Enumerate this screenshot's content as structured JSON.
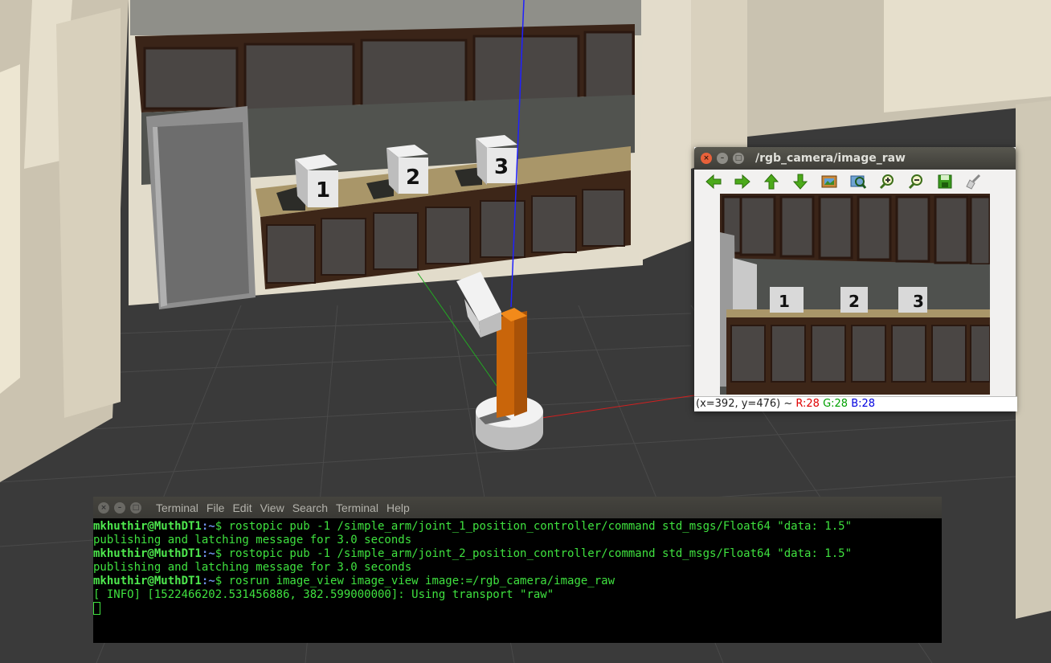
{
  "image_view": {
    "title": "/rgb_camera/image_raw",
    "toolbar_icons": [
      "arrow-left-icon",
      "arrow-right-icon",
      "arrow-up-icon",
      "arrow-down-icon",
      "image-icon",
      "fit-icon",
      "zoom-in-icon",
      "zoom-out-icon",
      "save-icon",
      "clear-icon"
    ],
    "cubes": [
      "1",
      "2",
      "3"
    ],
    "status": {
      "coords": "(x=392, y=476) ~ ",
      "r": "R:28",
      "g": "G:28",
      "b": "B:28"
    }
  },
  "scene": {
    "cubes": [
      "1",
      "2",
      "3"
    ]
  },
  "terminal": {
    "menu": [
      "Terminal",
      "File",
      "Edit",
      "View",
      "Search",
      "Terminal",
      "Help"
    ],
    "prompt_user": "mkhuthir@MuthDT1",
    "prompt_path": ":~",
    "prompt_symbol": "$ ",
    "lines": [
      {
        "type": "cmd",
        "text": "rostopic pub -1 /simple_arm/joint_1_position_controller/command std_msgs/Float64 \"data: 1.5\""
      },
      {
        "type": "out",
        "text": "publishing and latching message for 3.0 seconds"
      },
      {
        "type": "cmd",
        "text": "rostopic pub -1 /simple_arm/joint_2_position_controller/command std_msgs/Float64 \"data: 1.5\""
      },
      {
        "type": "out",
        "text": "publishing and latching message for 3.0 seconds"
      },
      {
        "type": "cmd",
        "text": "rosrun image_view image_view image:=/rgb_camera/image_raw"
      },
      {
        "type": "out",
        "text": "[ INFO] [1522466202.531456886, 382.599000000]: Using transport \"raw\""
      }
    ]
  },
  "colors": {
    "terminal_text": "#3fe13f",
    "accent_orange": "#d4700a"
  }
}
